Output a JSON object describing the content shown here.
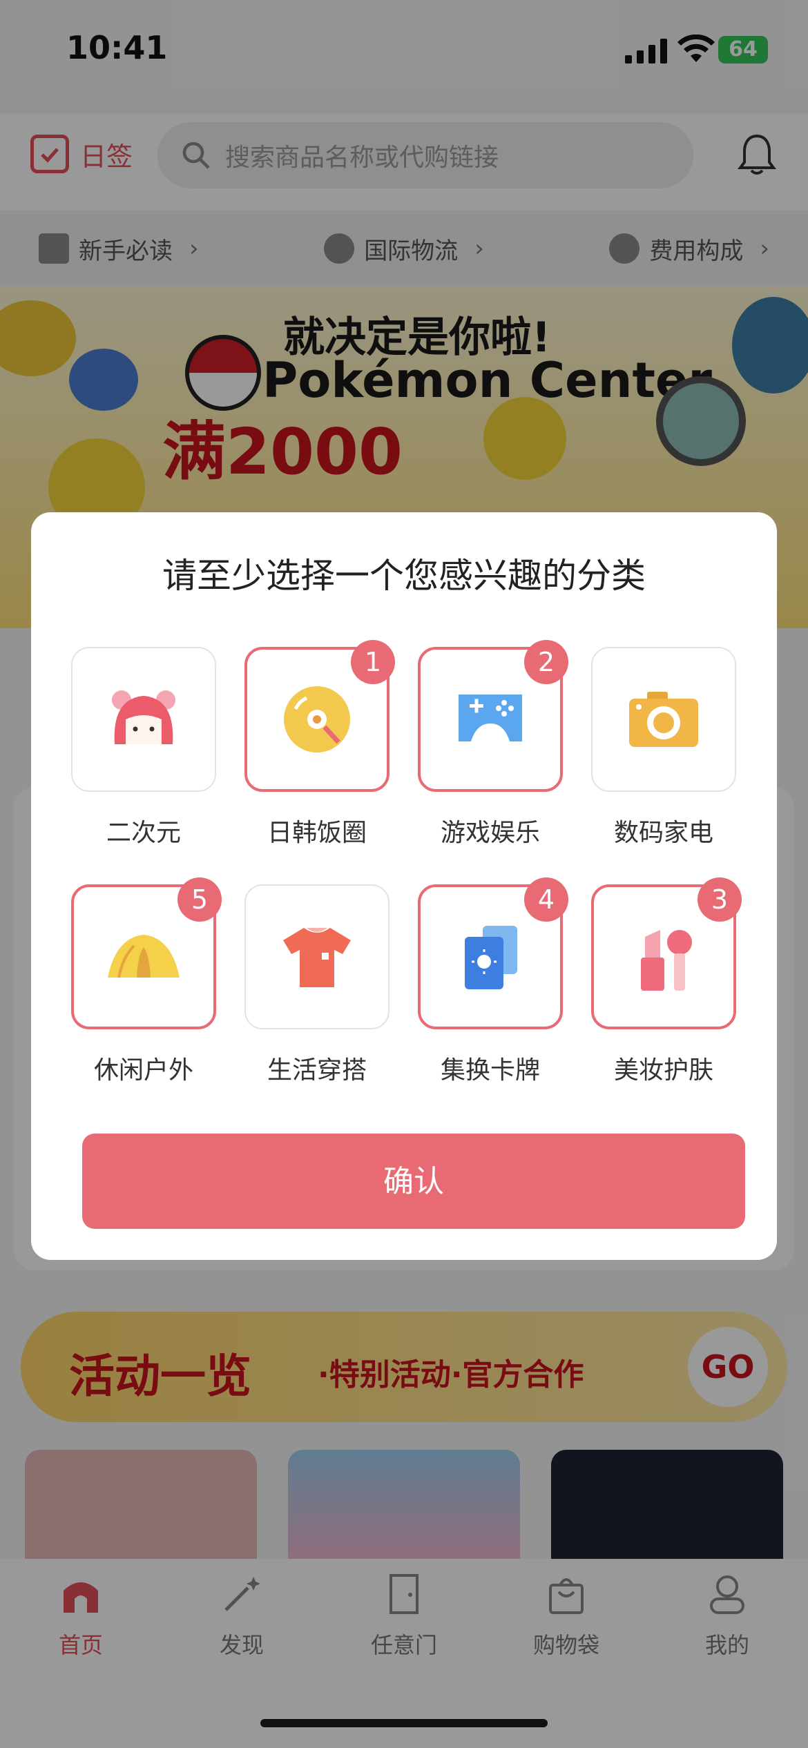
{
  "status_bar": {
    "time": "10:41",
    "battery": "64"
  },
  "header": {
    "checkin_label": "日签",
    "search_placeholder": "搜索商品名称或代购链接"
  },
  "quick_links": [
    {
      "label": "新手必读"
    },
    {
      "label": "国际物流"
    },
    {
      "label": "费用构成"
    }
  ],
  "banner": {
    "line1": "就决定是你啦!",
    "line2": "Pokémon Center",
    "line3": "满2000"
  },
  "activity_banner": {
    "title": "活动一览",
    "subtitle": "·特别活动·官方合作",
    "go_label": "GO"
  },
  "modal": {
    "title": "请至少选择一个您感兴趣的分类",
    "categories": [
      {
        "label": "二次元",
        "icon": "anime-girl-icon",
        "selected": false,
        "order": ""
      },
      {
        "label": "日韩饭圈",
        "icon": "record-disc-icon",
        "selected": true,
        "order": "1"
      },
      {
        "label": "游戏娱乐",
        "icon": "game-controller-icon",
        "selected": true,
        "order": "2"
      },
      {
        "label": "数码家电",
        "icon": "camera-icon",
        "selected": false,
        "order": ""
      },
      {
        "label": "休闲户外",
        "icon": "tent-icon",
        "selected": true,
        "order": "5"
      },
      {
        "label": "生活穿搭",
        "icon": "tshirt-icon",
        "selected": false,
        "order": ""
      },
      {
        "label": "集换卡牌",
        "icon": "trading-cards-icon",
        "selected": true,
        "order": "4"
      },
      {
        "label": "美妆护肤",
        "icon": "cosmetics-icon",
        "selected": true,
        "order": "3"
      }
    ],
    "confirm_label": "确认"
  },
  "tabbar": [
    {
      "label": "首页",
      "active": true
    },
    {
      "label": "发现",
      "active": false
    },
    {
      "label": "任意门",
      "active": false
    },
    {
      "label": "购物袋",
      "active": false
    },
    {
      "label": "我的",
      "active": false
    }
  ],
  "colors": {
    "accent": "#e86a74",
    "brand_red": "#e4505c"
  }
}
